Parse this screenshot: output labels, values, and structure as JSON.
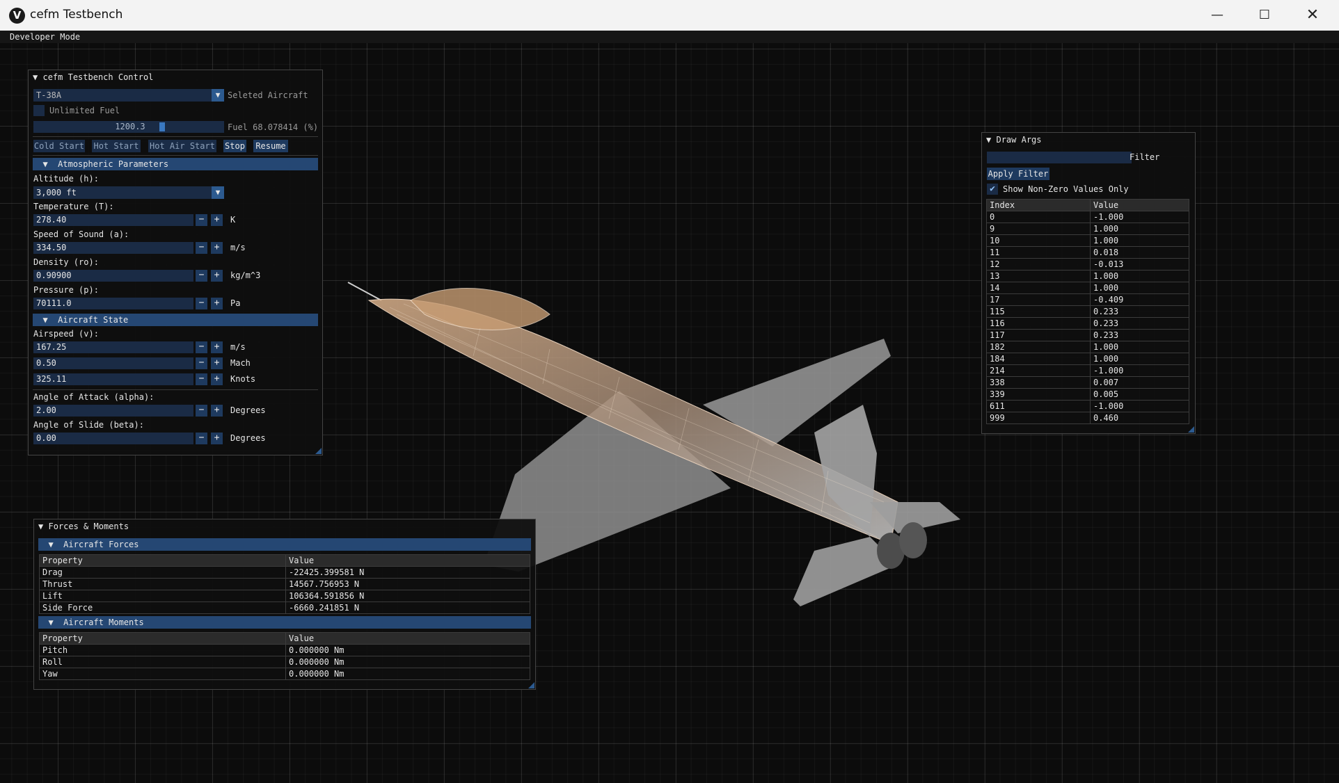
{
  "window": {
    "title": "cefm Testbench"
  },
  "menu": {
    "developer_mode": "Developer Mode"
  },
  "control": {
    "title": "cefm Testbench Control",
    "aircraft": "T-38A",
    "aircraft_label": "Seleted Aircraft",
    "unlimited_fuel_label": "Unlimited Fuel",
    "fuel_value": "1200.3",
    "fuel_label": "Fuel 68.078414 (%)",
    "buttons": {
      "cold_start": "Cold Start",
      "hot_start": "Hot Start",
      "hot_air_start": "Hot Air Start",
      "stop": "Stop",
      "resume": "Resume"
    },
    "atmo": {
      "header": "Atmospheric Parameters",
      "altitude_label": "Altitude (h):",
      "altitude_value": "3,000 ft",
      "temperature_label": "Temperature (T):",
      "temperature_value": "278.40",
      "temperature_unit": "K",
      "sound_label": "Speed of Sound (a):",
      "sound_value": "334.50",
      "sound_unit": "m/s",
      "density_label": "Density (ro):",
      "density_value": "0.90900",
      "density_unit": "kg/m^3",
      "pressure_label": "Pressure (p):",
      "pressure_value": "70111.0",
      "pressure_unit": "Pa"
    },
    "state": {
      "header": "Aircraft State",
      "airspeed_label": "Airspeed (v):",
      "airspeed_ms": "167.25",
      "unit_ms": "m/s",
      "mach": "0.50",
      "unit_mach": "Mach",
      "knots": "325.11",
      "unit_knots": "Knots",
      "aoa_label": "Angle of Attack (alpha):",
      "aoa_value": "2.00",
      "aoa_unit": "Degrees",
      "aos_label": "Angle of Slide (beta):",
      "aos_value": "0.00",
      "aos_unit": "Degrees"
    },
    "minus": "−",
    "plus": "+"
  },
  "draw_args": {
    "title": "Draw Args",
    "filter_label": "Filter",
    "apply_filter": "Apply Filter",
    "nonzero_label": "Show Non-Zero Values Only",
    "columns": [
      "Index",
      "Value"
    ],
    "rows": [
      [
        "0",
        "-1.000"
      ],
      [
        "9",
        "1.000"
      ],
      [
        "10",
        "1.000"
      ],
      [
        "11",
        "0.018"
      ],
      [
        "12",
        "-0.013"
      ],
      [
        "13",
        "1.000"
      ],
      [
        "14",
        "1.000"
      ],
      [
        "17",
        "-0.409"
      ],
      [
        "115",
        "0.233"
      ],
      [
        "116",
        "0.233"
      ],
      [
        "117",
        "0.233"
      ],
      [
        "182",
        "1.000"
      ],
      [
        "184",
        "1.000"
      ],
      [
        "214",
        "-1.000"
      ],
      [
        "338",
        "0.007"
      ],
      [
        "339",
        "0.005"
      ],
      [
        "611",
        "-1.000"
      ],
      [
        "999",
        "0.460"
      ]
    ]
  },
  "forces": {
    "title": "Forces & Moments",
    "forces_header": "Aircraft Forces",
    "moments_header": "Aircraft Moments",
    "columns": [
      "Property",
      "Value"
    ],
    "force_rows": [
      [
        "Drag",
        "-22425.399581 N"
      ],
      [
        "Thrust",
        "14567.756953 N"
      ],
      [
        "Lift",
        "106364.591856 N"
      ],
      [
        "Side Force",
        "-6660.241851 N"
      ]
    ],
    "moment_rows": [
      [
        "Pitch",
        "0.000000 Nm"
      ],
      [
        "Roll",
        "0.000000 Nm"
      ],
      [
        "Yaw",
        "0.000000 Nm"
      ]
    ]
  }
}
